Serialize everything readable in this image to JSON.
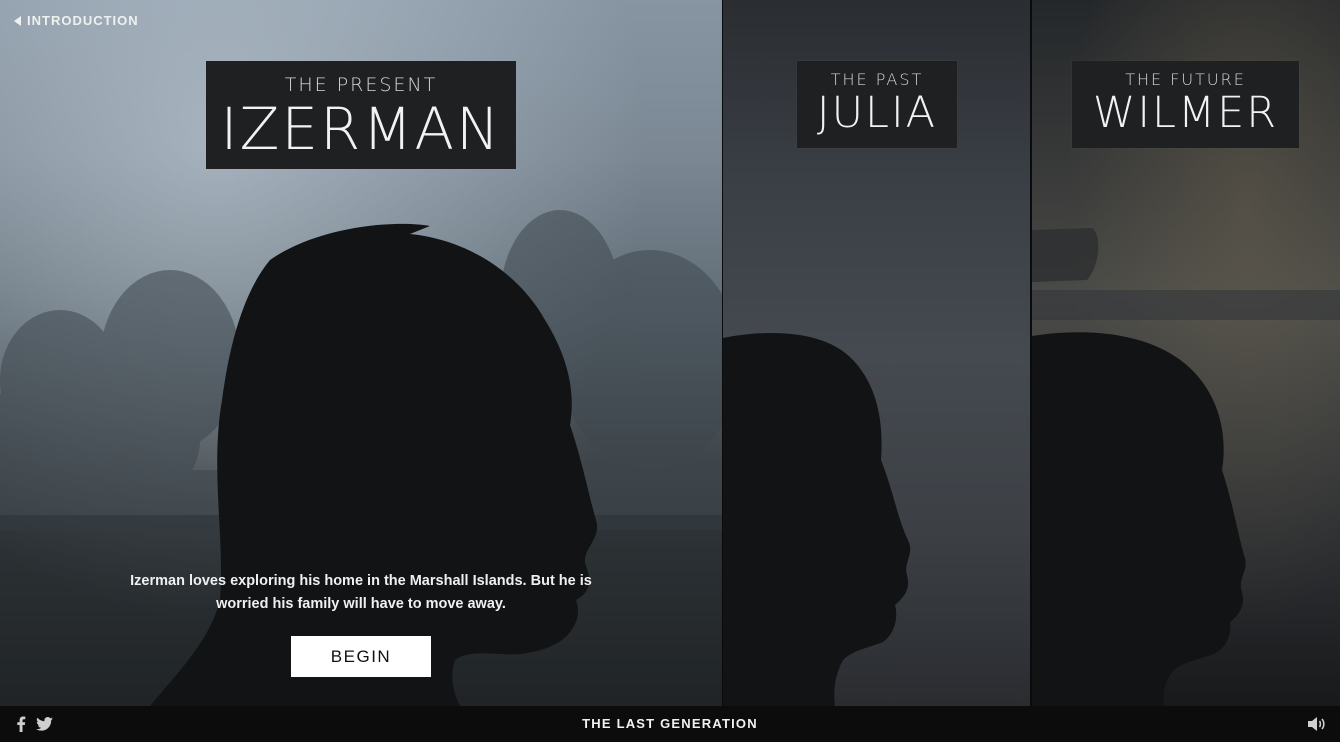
{
  "nav": {
    "back_label": "INTRODUCTION"
  },
  "panels": [
    {
      "era": "THE PRESENT",
      "name": "IZERMAN",
      "description": "Izerman loves exploring his home in the Marshall Islands. But he is worried his family will have to move away.",
      "cta": "BEGIN"
    },
    {
      "era": "THE PAST",
      "name": "JULIA"
    },
    {
      "era": "THE FUTURE",
      "name": "WILMER"
    }
  ],
  "footer": {
    "title": "THE LAST GENERATION",
    "icons": [
      "facebook-icon",
      "twitter-icon",
      "sound-icon"
    ]
  },
  "colors": {
    "silhouette": "#121314",
    "title_box": "#1f2021",
    "button": "#ffffff"
  }
}
